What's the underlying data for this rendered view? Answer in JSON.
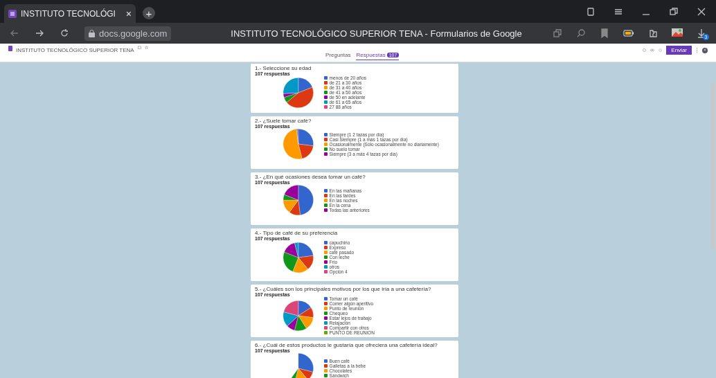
{
  "browser": {
    "tab": {
      "title": "INSTITUTO TECNOLÓGI",
      "close": "×"
    },
    "new_tab": "+",
    "address": "docs.google.com",
    "page_title": "INSTITUTO TECNOLÓGICO SUPERIOR TENA - Formularios de Google",
    "download_badge": "3"
  },
  "form_header": {
    "title": "INSTITUTO TECNOLÓGICO SUPERIOR TENA",
    "tabs": [
      {
        "label": "Preguntas",
        "selected": false
      },
      {
        "label": "Respuestas",
        "selected": true,
        "badge": "107"
      }
    ],
    "send_button": "Enviar"
  },
  "questions": [
    {
      "title": "1.- Seleccione su edad",
      "responses": "107 respuestas",
      "legend": [
        {
          "label": "menos de 20 años",
          "color": "#3366cc"
        },
        {
          "label": "de 21 a 30 años",
          "color": "#dc3912"
        },
        {
          "label": "de 31 a 40 años",
          "color": "#ff9900"
        },
        {
          "label": "de 41 a 50 años",
          "color": "#109618"
        },
        {
          "label": "de 50 en adelante",
          "color": "#990099"
        },
        {
          "label": "de 61 a 65 años",
          "color": "#0099c6"
        },
        {
          "label": "27 88 años",
          "color": "#dd4477"
        }
      ]
    },
    {
      "title": "2.- ¿Suele tomar café?",
      "responses": "107 respuestas",
      "legend": [
        {
          "label": "Siempre (1 2 tazas por día)",
          "color": "#3366cc"
        },
        {
          "label": "Casi Siempre (1 a más 1 tazas por día)",
          "color": "#dc3912"
        },
        {
          "label": "Ocasionalmente (Sólo ocasionalmente no diariamente)",
          "color": "#ff9900"
        },
        {
          "label": "No suelo tomar",
          "color": "#109618"
        },
        {
          "label": "Siempre (3 a más 4 tazas por día)",
          "color": "#990099"
        }
      ]
    },
    {
      "title": "3.- ¿En qué ocasiones desea tomar un café?",
      "responses": "107 respuestas",
      "legend": [
        {
          "label": "En las mañanas",
          "color": "#3366cc"
        },
        {
          "label": "En las tardes",
          "color": "#dc3912"
        },
        {
          "label": "En las noches",
          "color": "#ff9900"
        },
        {
          "label": "En la cena",
          "color": "#109618"
        },
        {
          "label": "Todas las anteriores",
          "color": "#990099"
        }
      ]
    },
    {
      "title": "4.- Tipo de café de su preferencia",
      "responses": "107 respuestas",
      "legend": [
        {
          "label": "capuchino",
          "color": "#3366cc"
        },
        {
          "label": "Expreso",
          "color": "#dc3912"
        },
        {
          "label": "café pasado",
          "color": "#ff9900"
        },
        {
          "label": "Con leche",
          "color": "#109618"
        },
        {
          "label": "Frío",
          "color": "#990099"
        },
        {
          "label": "otros",
          "color": "#0099c6"
        },
        {
          "label": "Opción 4",
          "color": "#dd4477"
        }
      ]
    },
    {
      "title": "5.- ¿Cuáles son los principales motivos por los que iría a una cafetería?",
      "responses": "107 respuestas",
      "legend": [
        {
          "label": "Tomar un café",
          "color": "#3366cc"
        },
        {
          "label": "Comer algún aperitivo",
          "color": "#dc3912"
        },
        {
          "label": "Punto de reunión",
          "color": "#ff9900"
        },
        {
          "label": "Chequeo",
          "color": "#109618"
        },
        {
          "label": "Estar lejos de trabajo",
          "color": "#990099"
        },
        {
          "label": "Relajación",
          "color": "#0099c6"
        },
        {
          "label": "Compartir con otros",
          "color": "#dd4477"
        },
        {
          "label": "PUNTO DE REUNION",
          "color": "#66aa00"
        }
      ]
    },
    {
      "title": "6.- ¿Cuál de estos productos le gustaría que ofreciera una cafetería ideal?",
      "responses": "107 respuestas",
      "legend": [
        {
          "label": "Buen café",
          "color": "#3366cc"
        },
        {
          "label": "Galletas a la bebe",
          "color": "#dc3912"
        },
        {
          "label": "Chocolates",
          "color": "#ff9900"
        },
        {
          "label": "Sándwich",
          "color": "#109618"
        }
      ]
    }
  ]
}
